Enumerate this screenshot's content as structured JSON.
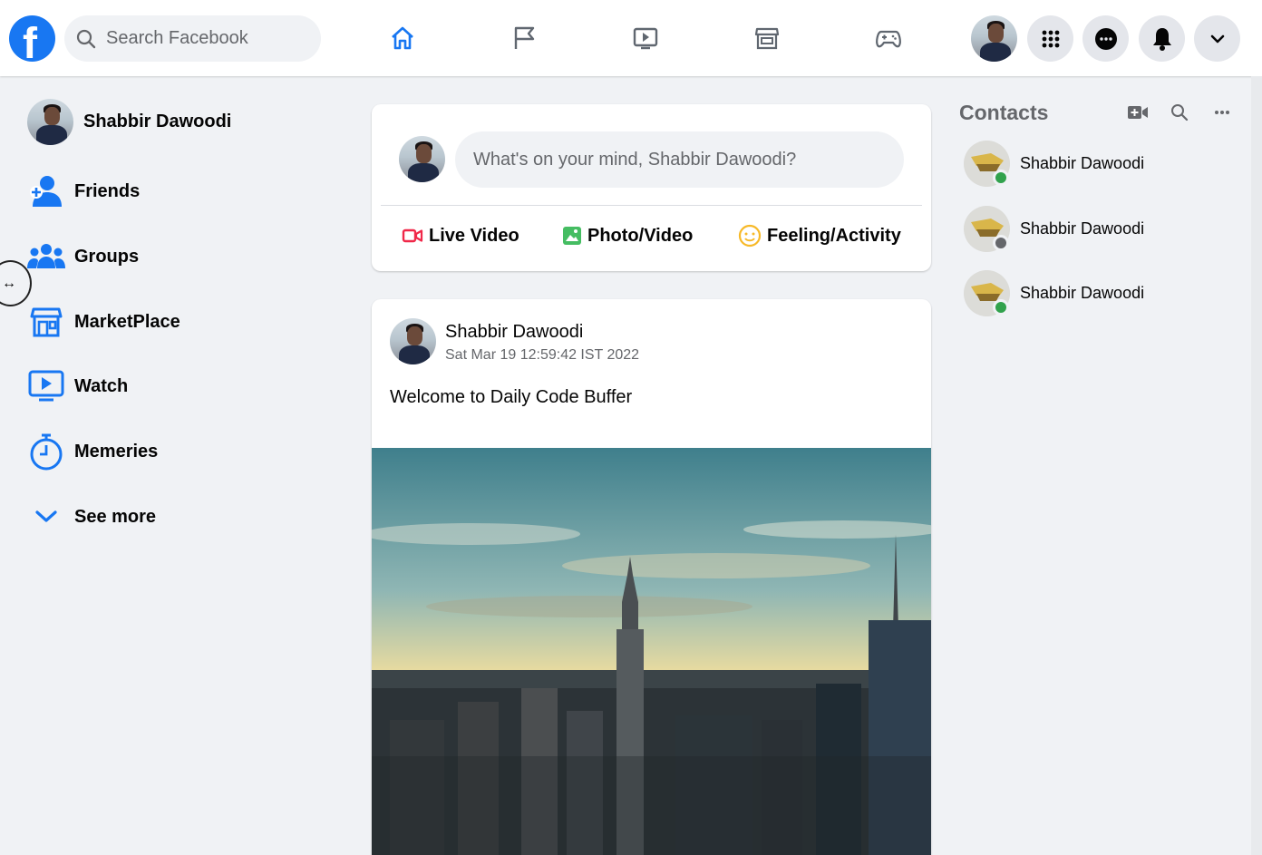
{
  "header": {
    "logo_letter": "f",
    "search_placeholder": "Search Facebook",
    "nav": [
      "home-icon",
      "flag-icon",
      "watch-icon",
      "marketplace-icon",
      "gaming-icon"
    ],
    "brand_color": "#1877f2"
  },
  "sidebar": {
    "profile_name": "Shabbir Dawoodi",
    "items": [
      {
        "label": "Friends",
        "icon": "friends-icon"
      },
      {
        "label": "Groups",
        "icon": "groups-icon"
      },
      {
        "label": "MarketPlace",
        "icon": "marketplace-icon"
      },
      {
        "label": "Watch",
        "icon": "watch-icon"
      },
      {
        "label": "Memeries",
        "icon": "memories-icon"
      },
      {
        "label": "See more",
        "icon": "chevron-down-icon"
      }
    ]
  },
  "composer": {
    "placeholder": "What's on your mind, Shabbir Dawoodi?",
    "live_video": "Live Video",
    "photo_video": "Photo/Video",
    "feeling": "Feeling/Activity"
  },
  "post": {
    "author": "Shabbir Dawoodi",
    "timestamp": "Sat Mar 19 12:59:42 IST 2022",
    "text": "Welcome to Daily Code Buffer"
  },
  "contacts": {
    "title": "Contacts",
    "list": [
      {
        "name": "Shabbir Dawoodi",
        "status": "online",
        "status_color": "#31a24c"
      },
      {
        "name": "Shabbir Dawoodi",
        "status": "offline",
        "status_color": "#65676b"
      },
      {
        "name": "Shabbir Dawoodi",
        "status": "online",
        "status_color": "#31a24c"
      }
    ]
  }
}
